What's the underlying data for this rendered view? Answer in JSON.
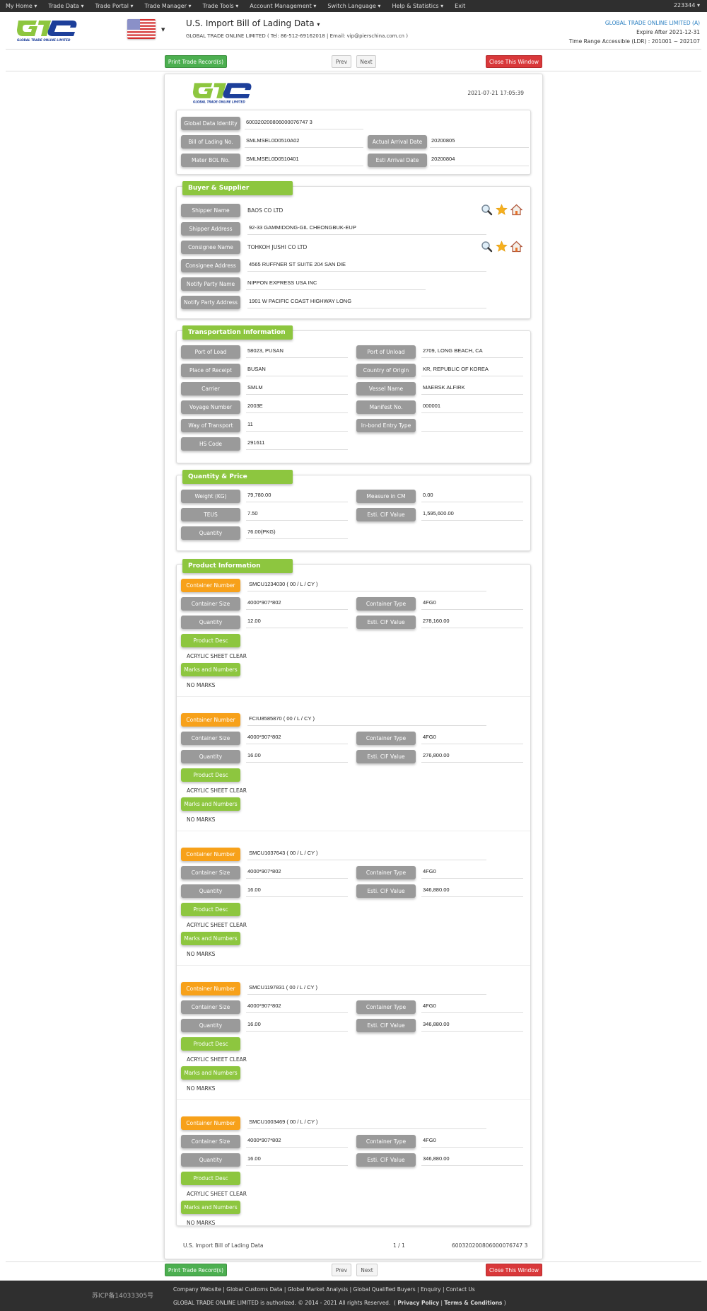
{
  "topnav": {
    "items": [
      "My Home",
      "Trade Data",
      "Trade Portal",
      "Trade Manager",
      "Trade Tools",
      "Account Management",
      "Switch Language",
      "Help & Statistics",
      "Exit"
    ],
    "user": "223344"
  },
  "header": {
    "logo_text": "GLOBAL TRADE ONLINE LIMITED",
    "title": "U.S. Import Bill of Lading Data",
    "company_line": "GLOBAL TRADE ONLINE LIMITED ( Tel: 86-512-69162018 | Email: vip@pierschina.com.cn )",
    "account_name": "GLOBAL TRADE ONLINE LIMITED (A)",
    "expire": "Expire After 2021-12-31",
    "time_range": "Time Range Accessible (LDR) : 201001 ~ 202107"
  },
  "toolbar": {
    "print": "Print Trade Record(s)",
    "prev": "Prev",
    "next": "Next",
    "close": "Close This Window"
  },
  "record": {
    "timestamp": "2021-07-21 17:05:39",
    "identity": {
      "global_data_identity_label": "Global Data Identity",
      "global_data_identity": "600320200806000076747 3",
      "bol_label": "Bill of Lading No.",
      "bol": "SMLMSEL0D0510A02",
      "actual_arrival_label": "Actual Arrival Date",
      "actual_arrival": "20200805",
      "master_bol_label": "Mater BOL No.",
      "master_bol": "SMLMSEL0D0510401",
      "esti_arrival_label": "Esti Arrival Date",
      "esti_arrival": "20200804"
    },
    "buyer_supplier": {
      "title": "Buyer & Supplier Information",
      "shipper_name_label": "Shipper Name",
      "shipper_name": "BAOS CO LTD",
      "shipper_address_label": "Shipper Address",
      "shipper_address": "92-33 GAMMIDONG-GIL CHEONGBUK-EUP",
      "consignee_name_label": "Consignee Name",
      "consignee_name": "TOHKOH JUSHI CO LTD",
      "consignee_address_label": "Consignee Address",
      "consignee_address": "4565 RUFFNER ST SUITE 204 SAN DIE",
      "notify_name_label": "Notify Party Name",
      "notify_name": "NIPPON EXPRESS USA INC",
      "notify_address_label": "Notify Party Address",
      "notify_address": "1901 W PACIFIC COAST HIGHWAY LONG"
    },
    "transport": {
      "title": "Transportation Information",
      "port_load_label": "Port of Load",
      "port_load": "58023, PUSAN",
      "port_unload_label": "Port of Unload",
      "port_unload": "2709, LONG BEACH, CA",
      "place_receipt_label": "Place of Receipt",
      "place_receipt": "BUSAN",
      "country_origin_label": "Country of Origin",
      "country_origin": "KR, REPUBLIC OF KOREA",
      "carrier_label": "Carrier",
      "carrier": "SMLM",
      "vessel_label": "Vessel Name",
      "vessel": "MAERSK ALFIRK",
      "voyage_label": "Voyage Number",
      "voyage": "2003E",
      "manifest_label": "Manifest No.",
      "manifest": "000001",
      "way_label": "Way of Transport",
      "way": "11",
      "inbond_label": "In-bond Entry Type",
      "inbond": "",
      "hs_label": "HS Code",
      "hs": "291611"
    },
    "quantity_price": {
      "title": "Quantity & Price Information",
      "weight_label": "Weight (KG)",
      "weight": "79,780.00",
      "measure_label": "Measure in CM",
      "measure": "0.00",
      "teus_label": "TEUS",
      "teus": "7.50",
      "cif_label": "Esti. CIF Value",
      "cif": "1,595,600.00",
      "quantity_label": "Quantity",
      "quantity": "76.00(PKG)"
    },
    "product": {
      "title": "Product Information",
      "labels": {
        "container_number": "Container Number",
        "container_size": "Container Size",
        "container_type": "Container Type",
        "quantity": "Quantity",
        "cif": "Esti. CIF Value",
        "desc": "Product Desc",
        "marks": "Marks and Numbers"
      },
      "containers": [
        {
          "number": "SMCU1234030 ( 00 / L / CY )",
          "size": "4000*907*802",
          "type": "4FG0",
          "quantity": "12.00",
          "cif": "278,160.00",
          "desc": "ACRYLIC SHEET CLEAR",
          "marks": "NO MARKS"
        },
        {
          "number": "FCIU8585870 ( 00 / L / CY )",
          "size": "4000*907*802",
          "type": "4FG0",
          "quantity": "16.00",
          "cif": "276,800.00",
          "desc": "ACRYLIC SHEET CLEAR",
          "marks": "NO MARKS"
        },
        {
          "number": "SMCU1037643 ( 00 / L / CY )",
          "size": "4000*907*802",
          "type": "4FG0",
          "quantity": "16.00",
          "cif": "346,880.00",
          "desc": "ACRYLIC SHEET CLEAR",
          "marks": "NO MARKS"
        },
        {
          "number": "SMCU1197831 ( 00 / L / CY )",
          "size": "4000*907*802",
          "type": "4FG0",
          "quantity": "16.00",
          "cif": "346,880.00",
          "desc": "ACRYLIC SHEET CLEAR",
          "marks": "NO MARKS"
        },
        {
          "number": "SMCU1003469 ( 00 / L / CY )",
          "size": "4000*907*802",
          "type": "4FG0",
          "quantity": "16.00",
          "cif": "346,880.00",
          "desc": "ACRYLIC SHEET CLEAR",
          "marks": "NO MARKS"
        }
      ]
    },
    "footer": {
      "source": "U.S. Import Bill of Lading Data",
      "page": "1 / 1",
      "identity": "600320200806000076747 3"
    }
  },
  "footer": {
    "icp": "苏ICP备14033305号",
    "links": [
      "Company Website",
      "Global Customs Data",
      "Global Market Analysis",
      "Global Qualified Buyers",
      "Enquiry",
      "Contact Us"
    ],
    "copyright": "GLOBAL TRADE ONLINE LIMITED is authorized. © 2014 - 2021 All rights Reserved.",
    "privacy": "Privacy Policy",
    "terms": "Terms & Conditions"
  },
  "icons": {
    "search": "magnifier-icon",
    "favorite": "star-icon",
    "home": "house-icon"
  }
}
